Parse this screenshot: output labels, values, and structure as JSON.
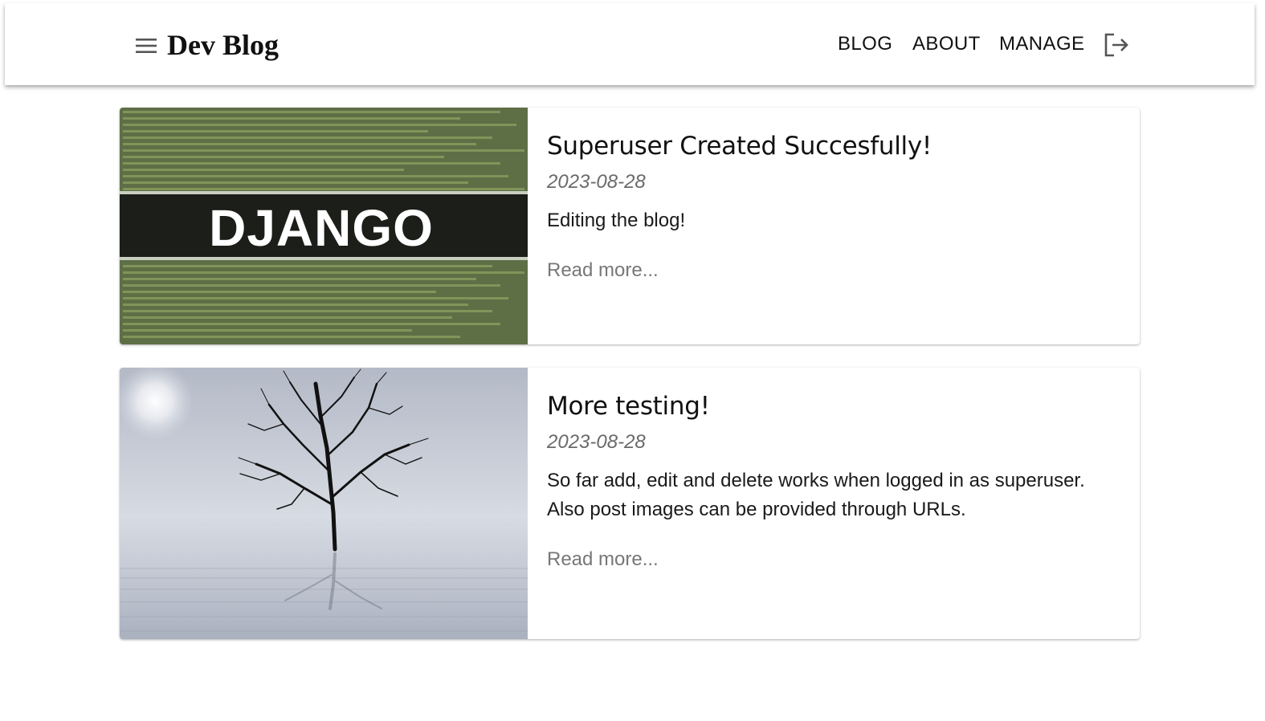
{
  "header": {
    "brand": "Dev Blog",
    "nav": [
      {
        "label": "BLOG"
      },
      {
        "label": "ABOUT"
      },
      {
        "label": "MANAGE"
      }
    ],
    "menu_icon": "hamburger-menu-icon",
    "logout_icon": "logout-icon"
  },
  "posts": [
    {
      "title": "Superuser Created Succesfully!",
      "date": "2023-08-28",
      "excerpt": "Editing the blog!",
      "read_more": "Read more...",
      "image_label": "DJANGO",
      "image_alt_desc": "django-code-banner"
    },
    {
      "title": "More testing!",
      "date": "2023-08-28",
      "excerpt": "So far add, edit and delete works when logged in as superuser. Also post images can be provided through URLs.",
      "read_more": "Read more...",
      "image_alt_desc": "tree-in-water"
    }
  ],
  "colors": {
    "text": "#111111",
    "date": "#6a6a6a",
    "read_more": "#777777",
    "django_green": "#5e6f46",
    "django_band": "#1c1e19"
  }
}
